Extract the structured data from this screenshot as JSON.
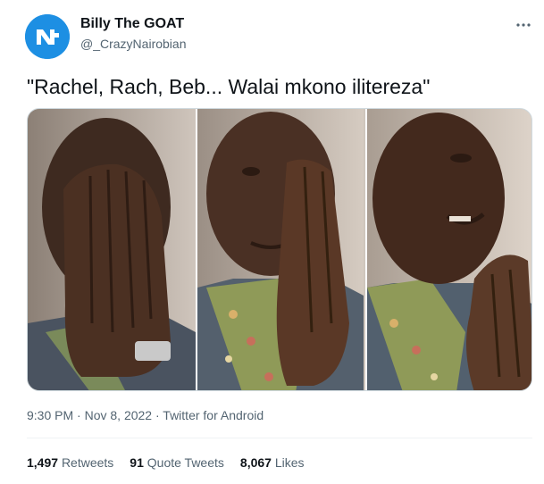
{
  "author": {
    "display_name": "Billy The GOAT",
    "handle": "@_CrazyNairobian",
    "avatar_icon": "brand-logo-icon",
    "avatar_color": "#1d8fe3"
  },
  "menu": {
    "icon": "more-horizontal-icon"
  },
  "tweet": {
    "text": "\"Rachel, Rach, Beb... Walai mkono ilitereza\""
  },
  "media": {
    "photos": [
      {
        "name": "man-covering-face-with-hands"
      },
      {
        "name": "man-crying-hands-pressed"
      },
      {
        "name": "man-looking-up-hands-clasped"
      }
    ]
  },
  "meta": {
    "time": "9:30 PM",
    "separator1": " · ",
    "date": "Nov 8, 2022",
    "separator2": " · ",
    "source": "Twitter for Android"
  },
  "stats": {
    "retweets": {
      "count": "1,497",
      "label": "Retweets"
    },
    "quotes": {
      "count": "91",
      "label": "Quote Tweets"
    },
    "likes": {
      "count": "8,067",
      "label": "Likes"
    }
  },
  "colors": {
    "text_primary": "#0f1419",
    "text_secondary": "#536471",
    "accent": "#1d9bf0",
    "divider": "#eff3f4"
  }
}
